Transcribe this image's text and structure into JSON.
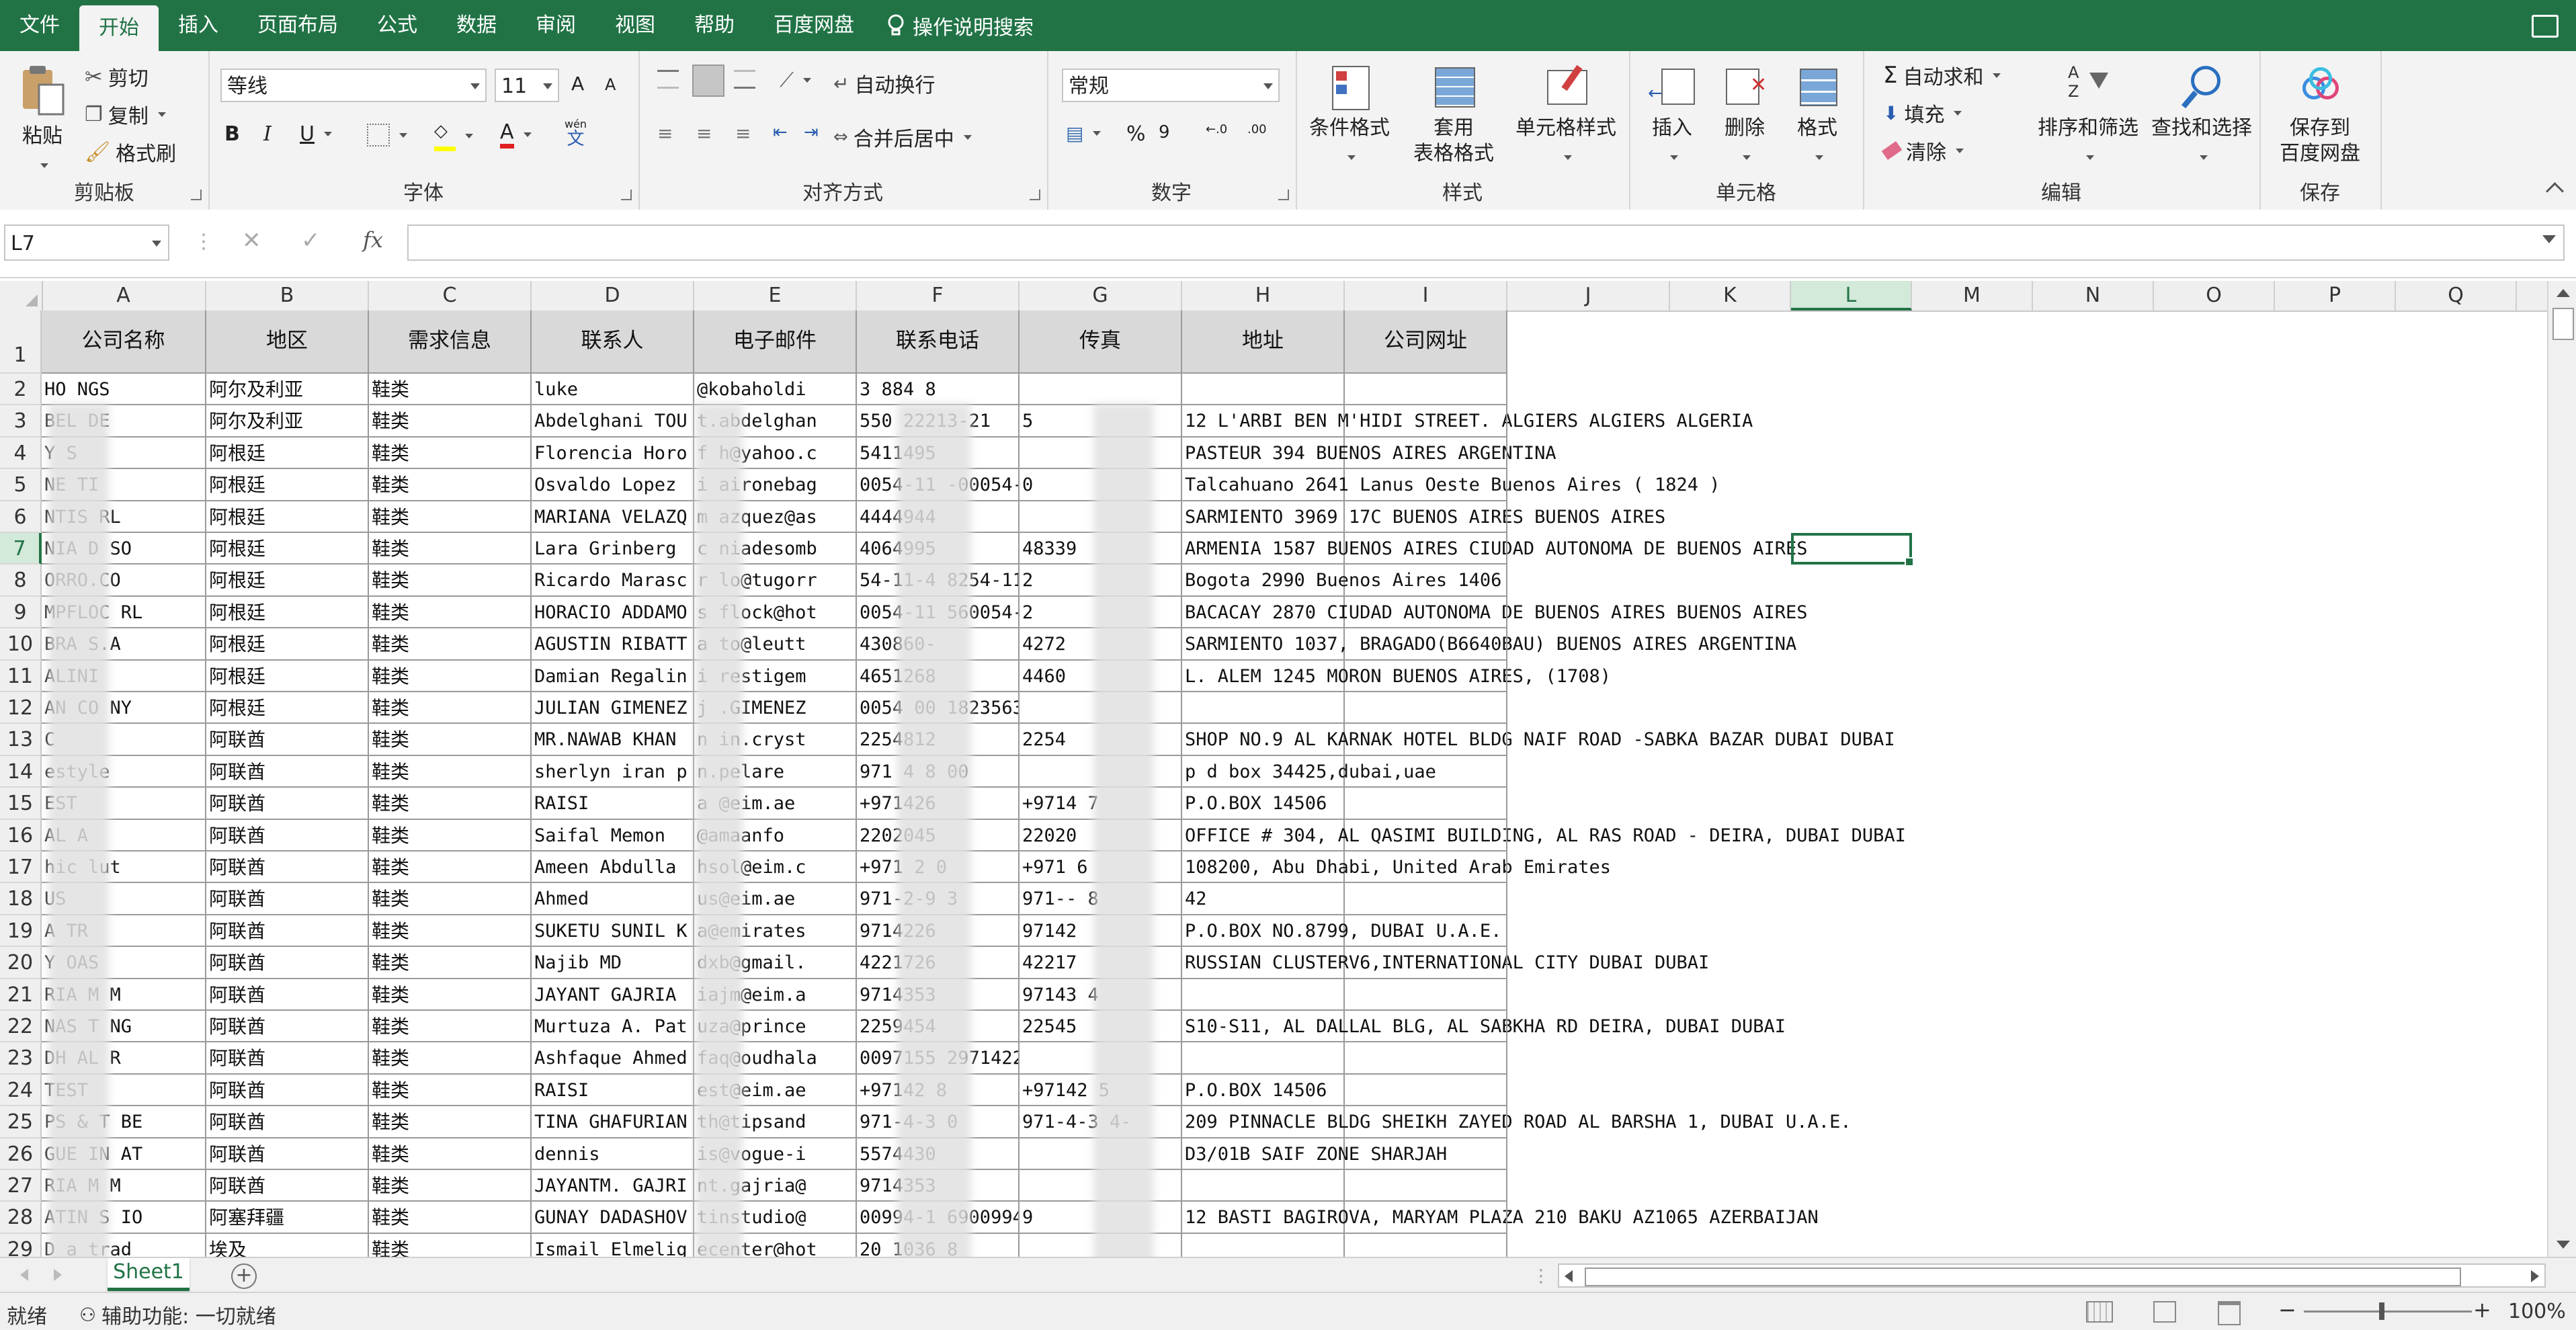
{
  "menu": {
    "tabs": [
      "文件",
      "开始",
      "插入",
      "页面布局",
      "公式",
      "数据",
      "审阅",
      "视图",
      "帮助",
      "百度网盘"
    ],
    "active_index": 1,
    "tell_me": "操作说明搜索"
  },
  "ribbon": {
    "clipboard": {
      "label": "剪贴板",
      "paste": "粘贴",
      "cut": "剪切",
      "copy": "复制",
      "format_painter": "格式刷"
    },
    "font": {
      "label": "字体",
      "font_name": "等线",
      "font_size": "11",
      "bold": "B",
      "italic": "I",
      "underline": "U",
      "font_color_letter": "A",
      "phonetic": "wén",
      "phonetic_char": "文",
      "grow": "A",
      "shrink": "A"
    },
    "alignment": {
      "label": "对齐方式",
      "wrap_text": "自动换行",
      "merge_center": "合并后居中"
    },
    "number": {
      "label": "数字",
      "format": "常规",
      "percent": "%",
      "comma": "9"
    },
    "styles": {
      "label": "样式",
      "conditional": "条件格式",
      "table_line1": "套用",
      "table_line2": "表格格式",
      "cell_styles": "单元格样式"
    },
    "cells": {
      "label": "单元格",
      "insert": "插入",
      "delete": "删除",
      "format": "格式"
    },
    "editing": {
      "label": "编辑",
      "autosum": "自动求和",
      "fill": "填充",
      "clear": "清除",
      "sort_filter": "排序和筛选",
      "find_select": "查找和选择"
    },
    "save": {
      "label": "保存",
      "line1": "保存到",
      "line2": "百度网盘"
    }
  },
  "formula_bar": {
    "name_box": "L7",
    "fx": "fx",
    "value": ""
  },
  "columns": [
    "A",
    "B",
    "C",
    "D",
    "E",
    "F",
    "G",
    "H",
    "I",
    "J",
    "K",
    "L",
    "M",
    "N",
    "O",
    "P",
    "Q"
  ],
  "selected_col": "L",
  "selected_row": 7,
  "header_row": [
    "公司名称",
    "地区",
    "需求信息",
    "联系人",
    "电子邮件",
    "联系电话",
    "传真",
    "地址",
    "公司网址"
  ],
  "rows": [
    {
      "n": 2,
      "a": "    HO    NGS",
      "b": "阿尔及利亚",
      "c": "鞋类",
      "d": "luke",
      "e": "  @kobaholdi",
      "f": "3 884  8",
      "g": "",
      "h": ""
    },
    {
      "n": 3,
      "a": "    BEL   DE",
      "b": "阿尔及利亚",
      "c": "鞋类",
      "d": "Abdelghani TOU",
      "e": "t.abdelghan",
      "f": "   550   22213-21",
      "g": "     5",
      "h": "12 L'ARBI BEN M'HIDI STREET. ALGIERS ALGIERS ALGERIA"
    },
    {
      "n": 4,
      "a": "    Y S",
      "b": "阿根廷",
      "c": "鞋类",
      "d": "Florencia Horo",
      "e": "f  h@yahoo.c",
      "f": "5411495",
      "g": "",
      "h": "PASTEUR 394 BUENOS AIRES ARGENTINA"
    },
    {
      "n": 5,
      "a": "    NE    TI",
      "b": "阿根廷",
      "c": "鞋类",
      "d": "Osvaldo Lopez",
      "e": "i  aironebag",
      "f": "0054-11    -00054-1",
      "g": "     0",
      "h": "Talcahuano 2641 Lanus Oeste  Buenos Aires ( 1824 )"
    },
    {
      "n": 6,
      "a": "    NTIS  RL",
      "b": "阿根廷",
      "c": "鞋类",
      "d": "MARIANA VELAZQ",
      "e": "m  azquez@as",
      "f": "4444944",
      "g": "",
      "h": "SARMIENTO 3969 17C BUENOS AIRES BUENOS AIRES"
    },
    {
      "n": 7,
      "a": "    NIA D  SO",
      "b": "阿根廷",
      "c": "鞋类",
      "d": "Lara Grinberg",
      "e": "c  niadesomb",
      "f": "4064995",
      "g": "  48339",
      "h": "ARMENIA 1587 BUENOS AIRES CIUDAD AUTONOMA DE BUENOS AIRES"
    },
    {
      "n": 8,
      "a": "    ORRO.CO",
      "b": "阿根廷",
      "c": "鞋类",
      "d": "Ricardo Marasc",
      "e": "r  lo@tugorr",
      "f": "54-11-4    8254-11",
      "g": "     2",
      "h": "Bogota 2990 Buenos Aires 1406"
    },
    {
      "n": 9,
      "a": "    MPFLOC  RL",
      "b": "阿根廷",
      "c": "鞋类",
      "d": "HORACIO ADDAMO",
      "e": "s  flock@hot",
      "f": "0054-11    560054-",
      "g": "     2",
      "h": "BACACAY 2870 CIUDAD AUTONOMA DE BUENOS AIRES BUENOS AIRES"
    },
    {
      "n": 10,
      "a": "    BRA S.A",
      "b": "阿根廷",
      "c": "鞋类",
      "d": "AGUSTIN RIBATT",
      "e": "a  to@leutt",
      "f": "430860-",
      "g": "  4272",
      "h": "SARMIENTO 1037, BRAGADO(B6640BAU) BUENOS AIRES ARGENTINA"
    },
    {
      "n": 11,
      "a": "    ALINI",
      "b": "阿根廷",
      "c": "鞋类",
      "d": "Damian Regalin",
      "e": "i  restigem",
      "f": "4651268",
      "g": "  4460",
      "h": "L. ALEM 1245 MORON BUENOS AIRES, (1708)"
    },
    {
      "n": 12,
      "a": "    AN CO   NY",
      "b": "阿根廷",
      "c": "鞋类",
      "d": "JULIAN GIMENEZ",
      "e": "j   .GIMENEZ",
      "f": "0054 00   1823563",
      "g": "",
      "h": ""
    },
    {
      "n": 13,
      "a": "    C",
      "b": "阿联酋",
      "c": "鞋类",
      "d": "MR.NAWAB KHAN",
      "e": "n  in.cryst",
      "f": "2254812",
      "g": "  2254",
      "h": "SHOP NO.9 AL KARNAK HOTEL BLDG NAIF ROAD -SABKA BAZAR DUBAI DUBAI"
    },
    {
      "n": 14,
      "a": "    estyle",
      "b": "阿联酋",
      "c": "鞋类",
      "d": "sherlyn iran p",
      "e": "   n.pelare",
      "f": "971 4 8    00",
      "g": "",
      "h": "p d box 34425,dubai,uae"
    },
    {
      "n": 15,
      "a": "    EST",
      "b": "阿联酋",
      "c": "鞋类",
      "d": "RAISI",
      "e": "a   @eim.ae",
      "f": "+971426",
      "g": "+9714  7",
      "h": "P.O.BOX 14506"
    },
    {
      "n": 16,
      "a": "    AL   A",
      "b": "阿联酋",
      "c": "鞋类",
      "d": "Saifal Memon",
      "e": "   @amaanfo",
      "f": "2202045",
      "g": "  22020",
      "h": "OFFICE # 304, AL QASIMI BUILDING, AL RAS ROAD - DEIRA, DUBAI DUBAI"
    },
    {
      "n": 17,
      "a": "    hic  lut",
      "b": "阿联酋",
      "c": "鞋类",
      "d": "Ameen Abdulla",
      "e": "   hsol@eim.c",
      "f": "+971 2    0",
      "g": "+971    6",
      "h": "108200, Abu Dhabi, United Arab Emirates"
    },
    {
      "n": 18,
      "a": "    US",
      "b": "阿联酋",
      "c": "鞋类",
      "d": "Ahmed",
      "e": "   us@eim.ae",
      "f": "971-2-9    3",
      "g": "971--    8",
      "h": "42"
    },
    {
      "n": 19,
      "a": "    A TR",
      "b": "阿联酋",
      "c": "鞋类",
      "d": "SUKETU SUNIL K",
      "e": "   a@emirates",
      "f": "9714226",
      "g": "  97142",
      "h": "P.O.BOX NO.8799, DUBAI U.A.E."
    },
    {
      "n": 20,
      "a": "    Y OAS",
      "b": "阿联酋",
      "c": "鞋类",
      "d": "Najib MD",
      "e": "   dxb@gmail.",
      "f": "4221726",
      "g": "  42217",
      "h": "RUSSIAN CLUSTERV6,INTERNATIONAL CITY DUBAI DUBAI"
    },
    {
      "n": 21,
      "a": "    RIA M   M",
      "b": "阿联酋",
      "c": "鞋类",
      "d": "JAYANT GAJRIA",
      "e": "   iajm@eim.a",
      "f": "9714353",
      "g": "  97143  4",
      "h": ""
    },
    {
      "n": 22,
      "a": "    NAS T   NG",
      "b": "阿联酋",
      "c": "鞋类",
      "d": "Murtuza A. Pat",
      "e": "   uza@prince",
      "f": "2259454",
      "g": "  22545",
      "h": "S10-S11, AL DALLAL BLG, AL SABKHA RD DEIRA, DUBAI DUBAI"
    },
    {
      "n": 23,
      "a": "    DH AL   R",
      "b": "阿联酋",
      "c": "鞋类",
      "d": "Ashfaque Ahmed",
      "e": "   faq@oudhala",
      "f": "0097155    2971422",
      "g": "",
      "h": ""
    },
    {
      "n": 24,
      "a": "    TEST",
      "b": "阿联酋",
      "c": "鞋类",
      "d": "RAISI",
      "e": "   est@eim.ae",
      "f": "+97142    8",
      "g": "+97142    5",
      "h": "P.O.BOX 14506"
    },
    {
      "n": 25,
      "a": "    PS & T   BE",
      "b": "阿联酋",
      "c": "鞋类",
      "d": "TINA GHAFURIAN",
      "e": "   th@tipsand",
      "f": "971-4-3    0",
      "g": "971-4-3   4-",
      "h": "209 PINNACLE BLDG SHEIKH ZAYED ROAD AL BARSHA 1, DUBAI U.A.E."
    },
    {
      "n": 26,
      "a": "    GUE IN   AT",
      "b": "阿联酋",
      "c": "鞋类",
      "d": "dennis",
      "e": "   is@vogue-i",
      "f": "5574430",
      "g": "",
      "h": "D3/01B SAIF ZONE SHARJAH"
    },
    {
      "n": 27,
      "a": "    RIA M   M",
      "b": "阿联酋",
      "c": "鞋类",
      "d": "JAYANTM. GAJRI",
      "e": "   nt.gajria@",
      "f": "9714353",
      "g": "",
      "h": ""
    },
    {
      "n": 28,
      "a": "    ATIN S   IO",
      "b": "阿塞拜疆",
      "c": "鞋类",
      "d": "GUNAY DADASHOV",
      "e": "   tinstudio@",
      "f": "00994-1    6900994-",
      "g": "     9",
      "h": "12 BASTI BAGIROVA, MARYAM PLAZA 210 BAKU AZ1065 AZERBAIJAN"
    },
    {
      "n": 29,
      "a": "D   a trad",
      "b": "埃及",
      "c": "鞋类",
      "d": "Ismail Elmelig",
      "e": "   ecenter@hot",
      "f": "20 1036    8",
      "g": "",
      "h": ""
    }
  ],
  "sheet": {
    "name": "Sheet1",
    "add": "+"
  },
  "status": {
    "ready": "就绪",
    "accessibility": "辅助功能: 一切就绪",
    "zoom": "100%",
    "minus": "−",
    "plus": "+"
  },
  "colors": {
    "accent": "#217346",
    "header_fill": "#d9d9d9"
  }
}
